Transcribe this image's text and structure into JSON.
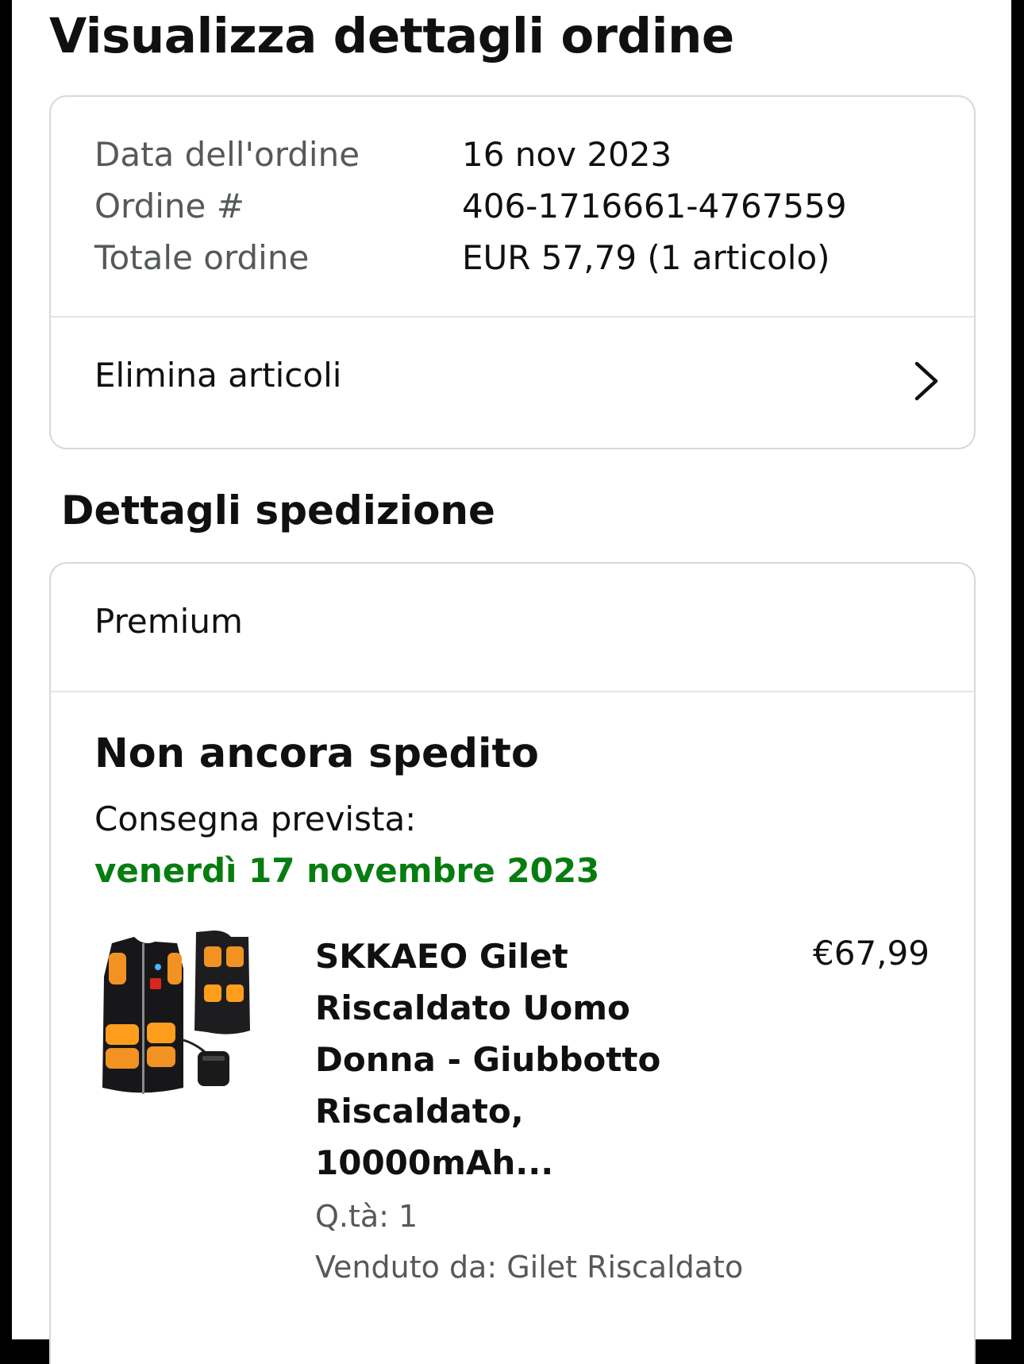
{
  "header": {
    "title": "Visualizza dettagli ordine"
  },
  "summary": {
    "rows": [
      {
        "label": "Data dell'ordine",
        "value": "16 nov 2023"
      },
      {
        "label": "Ordine #",
        "value": "406-1716661-4767559"
      },
      {
        "label": "Totale ordine",
        "value": "EUR 57,79 (1 articolo)"
      }
    ],
    "delete_label": "Elimina articoli",
    "delete_icon": "chevron-right-icon"
  },
  "shipping": {
    "section_title": "Dettagli spedizione",
    "method": "Premium",
    "status": "Non ancora spedito",
    "delivery_label": "Consegna prevista:",
    "delivery_date": "venerdì 17 novembre 2023",
    "delivery_date_color": "#067d0f",
    "item": {
      "image_icon": "heated-vest-product-image",
      "title": "SKKAEO Gilet Riscaldato Uomo Donna - Giubbotto Riscaldato, 10000mAh...",
      "price": "€67,99",
      "quantity": "Q.tà: 1",
      "seller": "Venduto da: Gilet Riscaldato"
    }
  },
  "colors": {
    "border": "#d5d9d9",
    "secondary_text": "#565959",
    "primary_text": "#0f1111",
    "heat_orange": "#f29222"
  }
}
